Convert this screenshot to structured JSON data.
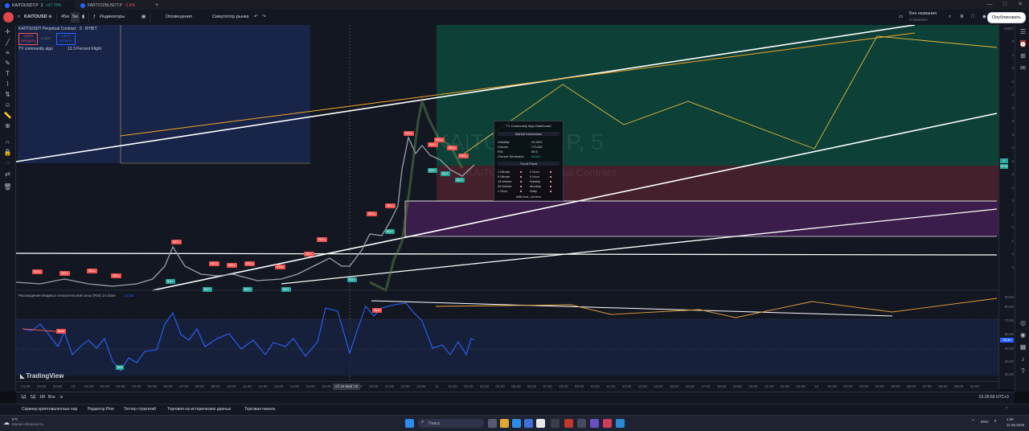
{
  "browser": {
    "tabs": [
      {
        "title": "KAITOUSDT.P",
        "badge": "2",
        "change": "+37.79%",
        "dir": "up"
      },
      {
        "title": "FARTCOINUSDT.P",
        "badge": "",
        "change": "-1.4%",
        "dir": "dn"
      }
    ],
    "window_controls": [
      "—",
      "□",
      "✕"
    ]
  },
  "toolbar": {
    "symbol": "KAITOUSD",
    "interval_45m": "45м",
    "interval_5m": "5м",
    "indicators_label": "Индикаторы",
    "alerts_label": "Оповещения",
    "replay_label": "Симулятор рынка",
    "layout_name": "Без названия",
    "layout_status": "Сохранено",
    "publish_label": "Опубликовать"
  },
  "legend": {
    "title": "KAITOUSDT Perpetual Contract · 5 · BYBIT",
    "sell_price": "1,8670",
    "sell_label": "ПРОДАТЬ",
    "spread": "0,0001",
    "buy_price": "1,8671",
    "buy_label": "КУПИТЬ",
    "indicator_1": "TV community algo",
    "indicator_2": "13 3 Percent Flight"
  },
  "watermark": {
    "symbol": "KAITOUSDT.P, 5",
    "subtitle": "KAITOUSDT Perpetual Contract"
  },
  "signals": {
    "sell": "SELL",
    "buy": "BUY"
  },
  "dashboard": {
    "title": "TV Community Algo Dashboard",
    "market_header": "Market Information",
    "volatility_label": "Volatility",
    "volatility_value": "25.36%",
    "volume_label": "Volume",
    "volume_value": "171428",
    "rsi_label": "RSI",
    "rsi_value": "56.5",
    "sentiment_label": "Current Sentiment",
    "sentiment_value": "Bullish",
    "trend_header": "Trend Panel",
    "trend_rows": [
      {
        "left": "1 Minute",
        "right": "2 Hour"
      },
      {
        "left": "5 Minute",
        "right": "4 Hour"
      },
      {
        "left": "15 Minute",
        "right": "Weekly"
      },
      {
        "left": "30 Minute",
        "right": "Monthly"
      },
      {
        "left": "1 Hour",
        "right": "Daily"
      }
    ],
    "footer": "with love, Lenzen"
  },
  "rsi_pane": {
    "legend": "Расхождение Индекса относительной силы (RSI) 14 close",
    "value": "47,55",
    "bear_label": "Bear",
    "bull_label": "Bull",
    "current_value": "55,30",
    "scale": [
      "90,00",
      "80,00",
      "70,00",
      "60,00",
      "50,00",
      "40,00",
      "30,00"
    ]
  },
  "branding": "TradingView",
  "price_scale": {
    "currency": "USDT",
    "labels": [
      "2",
      "2",
      "2",
      "2",
      "2",
      "2",
      "2",
      "2",
      "2",
      "2",
      "2",
      "2",
      "2",
      "1",
      "1",
      "1",
      "1",
      "1"
    ],
    "last_price": "2",
    "timer": "00:15"
  },
  "time_axis": {
    "labels": [
      "21:00",
      "22:00",
      "23:00",
      "10",
      "01:00",
      "02:00",
      "03:00",
      "04:00",
      "05:00",
      "06:00",
      "07:00",
      "08:00",
      "09:00",
      "10:00",
      "11:00",
      "12:00",
      "13:00",
      "14:00",
      "15:00",
      "16:00",
      "17:29",
      "19:00",
      "20:00",
      "21:00",
      "22:00",
      "23:00",
      "11",
      "01:00",
      "02:00",
      "03:00",
      "04:00",
      "05:00",
      "06:00",
      "07:00",
      "08:00",
      "09:00",
      "10:00",
      "11:00",
      "12:00",
      "13:00",
      "14:00",
      "15:00",
      "16:00",
      "17:00",
      "18:00",
      "19:00",
      "20:00",
      "21:00",
      "22:00",
      "23:00",
      "12",
      "01:00",
      "02:00",
      "03:00",
      "04:00",
      "05:00",
      "06:00",
      "07:00",
      "08:00",
      "09:00",
      "10:00"
    ],
    "cursor_label": "сб 10 Май '25"
  },
  "bottom_bar": {
    "ranges": [
      "1Д",
      "5Д",
      "1М",
      "Все"
    ],
    "clock": "01:26:59 UTC+3"
  },
  "panel_tabs": [
    "Скринер криптовалютных пар",
    "Редактор Pine",
    "Тестер стратегий",
    "Торговля на исторических данных",
    "Торговая панель"
  ],
  "taskbar": {
    "weather_temp": "6°C",
    "weather_text": "Малая облачность",
    "search_placeholder": "Поиск",
    "lang": "ENG",
    "time": "1:26",
    "date": "11.05.2025"
  },
  "colors": {
    "sell": "#ef5350",
    "buy": "#26a69a",
    "rsi": "#2962ff",
    "accent_yellow": "#e5b93b",
    "green_zone": "#0b3d33",
    "red_zone": "#3d1c25"
  }
}
